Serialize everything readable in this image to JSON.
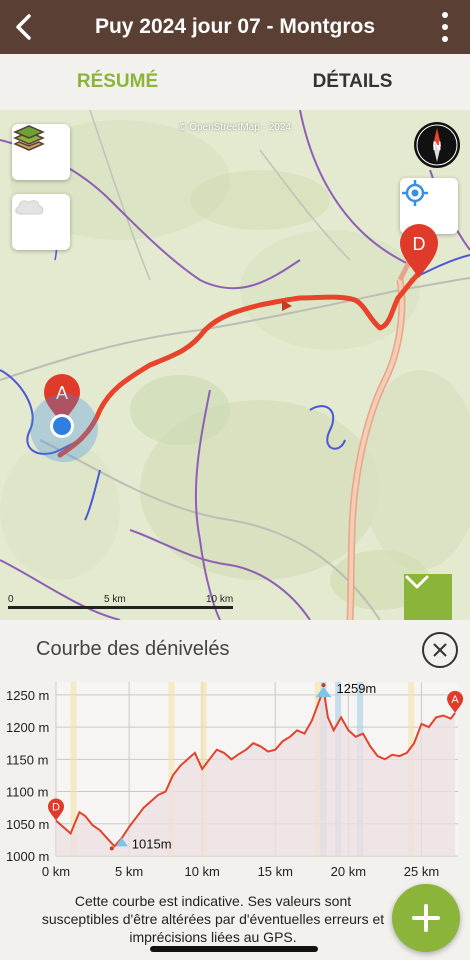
{
  "header": {
    "title": "Puy 2024 jour 07 - Montgros"
  },
  "tabs": {
    "resume": "RÉSUMÉ",
    "details": "DÉTAILS"
  },
  "map": {
    "attribution": "© OpenStreetMap · 2024",
    "compass_label": "N",
    "start_marker": "A",
    "end_marker": "D",
    "scale_labels": [
      "0",
      "5 km",
      "10 km"
    ]
  },
  "profile": {
    "title": "Courbe des dénivelés",
    "y_tick_labels": [
      "1250 m",
      "1200 m",
      "1150 m",
      "1100 m",
      "1050 m",
      "1000 m"
    ],
    "x_tick_labels": [
      "0 km",
      "5 km",
      "10 km",
      "15 km",
      "20 km",
      "25 km"
    ],
    "min_label": "1015m",
    "max_label": "1259m",
    "start_marker": "D",
    "end_marker": "A",
    "note": "Cette courbe est indicative. Ses valeurs sont susceptibles d'être altérées par d'éventuelles erreurs et imprécisions liées au GPS."
  },
  "chart_data": {
    "type": "area",
    "x": [
      0,
      1,
      1.6,
      2,
      2.5,
      3,
      3.6,
      4,
      4.5,
      5,
      5.5,
      6,
      6.5,
      7,
      7.5,
      8,
      8.5,
      9,
      9.5,
      10,
      10.5,
      11,
      11.5,
      12,
      12.5,
      13,
      13.5,
      14,
      14.5,
      15,
      15.5,
      16,
      16.5,
      17,
      17.5,
      18,
      18.3,
      18.6,
      19,
      19.5,
      20,
      20.5,
      21,
      21.5,
      22,
      22.5,
      23,
      23.5,
      24,
      24.5,
      25,
      25.5,
      26,
      26.5,
      27,
      27.3
    ],
    "y": [
      1055,
      1035,
      1068,
      1062,
      1048,
      1040,
      1025,
      1015,
      1028,
      1045,
      1060,
      1075,
      1085,
      1095,
      1100,
      1125,
      1140,
      1150,
      1160,
      1135,
      1150,
      1165,
      1160,
      1150,
      1158,
      1165,
      1175,
      1170,
      1162,
      1165,
      1178,
      1185,
      1195,
      1190,
      1210,
      1240,
      1259,
      1215,
      1195,
      1215,
      1195,
      1185,
      1190,
      1170,
      1155,
      1150,
      1157,
      1155,
      1160,
      1175,
      1205,
      1200,
      1215,
      1218,
      1213,
      1222
    ],
    "xlabel": "",
    "ylabel": "",
    "xlim": [
      0,
      27.5
    ],
    "ylim": [
      1000,
      1270
    ],
    "grid": true,
    "min": {
      "x": 4.5,
      "y": 1015
    },
    "max": {
      "x": 18.3,
      "y": 1259
    }
  }
}
